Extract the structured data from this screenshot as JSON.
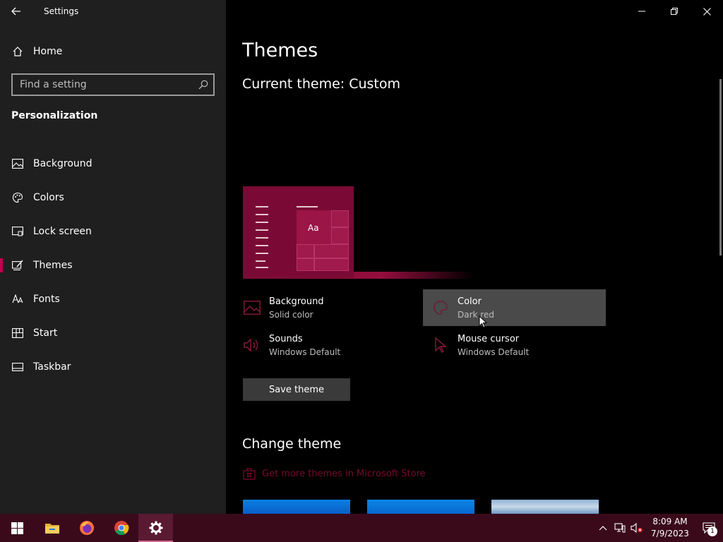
{
  "window": {
    "title": "Settings"
  },
  "sidebar": {
    "home_label": "Home",
    "search_placeholder": "Find a setting",
    "section_title": "Personalization",
    "items": [
      {
        "label": "Background",
        "icon": "picture-icon"
      },
      {
        "label": "Colors",
        "icon": "palette-icon"
      },
      {
        "label": "Lock screen",
        "icon": "lock-screen-icon"
      },
      {
        "label": "Themes",
        "icon": "themes-icon",
        "active": true
      },
      {
        "label": "Fonts",
        "icon": "fonts-icon"
      },
      {
        "label": "Start",
        "icon": "start-icon"
      },
      {
        "label": "Taskbar",
        "icon": "taskbar-icon"
      }
    ]
  },
  "main": {
    "page_title": "Themes",
    "current_theme": "Current theme: Custom",
    "preview_text": "Aa",
    "settings": {
      "background": {
        "title": "Background",
        "value": "Solid color"
      },
      "color": {
        "title": "Color",
        "value": "Dark red"
      },
      "sounds": {
        "title": "Sounds",
        "value": "Windows Default"
      },
      "mouse_cursor": {
        "title": "Mouse cursor",
        "value": "Windows Default"
      }
    },
    "save_button": "Save theme",
    "change_theme_title": "Change theme",
    "store_link": "Get more themes in Microsoft Store"
  },
  "taskbar": {
    "time": "8:09 AM",
    "date": "7/9/2023",
    "notification_count": "1",
    "apps": [
      "windows-start-icon",
      "file-explorer-icon",
      "firefox-icon",
      "chrome-icon",
      "settings-gear-icon"
    ]
  },
  "colors": {
    "accent": "#c30052",
    "theme_dark_red": "#7a0a35",
    "taskbar": "#3a0a1b"
  }
}
